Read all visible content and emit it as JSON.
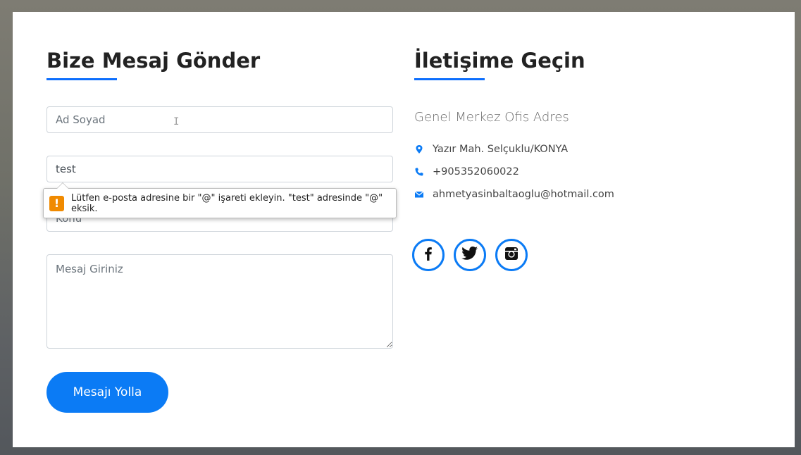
{
  "left": {
    "heading": "Bize Mesaj Gönder",
    "name_placeholder": "Ad Soyad",
    "email_value": "test",
    "subject_placeholder": "Konu",
    "message_placeholder": "Mesaj Giriniz",
    "submit_label": "Mesajı Yolla"
  },
  "validation": {
    "icon": "!",
    "message": "Lütfen e-posta adresine bir \"@\" işareti ekleyin. \"test\" adresinde \"@\" eksik."
  },
  "right": {
    "heading": "İletişime Geçin",
    "office_title": "Genel Merkez Ofis Adres",
    "address": "Yazır Mah. Selçuklu/KONYA",
    "phone": "+905352060022",
    "email": "ahmetyasinbaltaoglu@hotmail.com"
  },
  "icons": {
    "address": "map-marker-icon",
    "phone": "phone-icon",
    "email": "envelope-icon",
    "social": [
      "facebook-icon",
      "twitter-icon",
      "instagram-icon"
    ]
  },
  "colors": {
    "accent": "#0b7bf5",
    "warning": "#f08a00"
  }
}
